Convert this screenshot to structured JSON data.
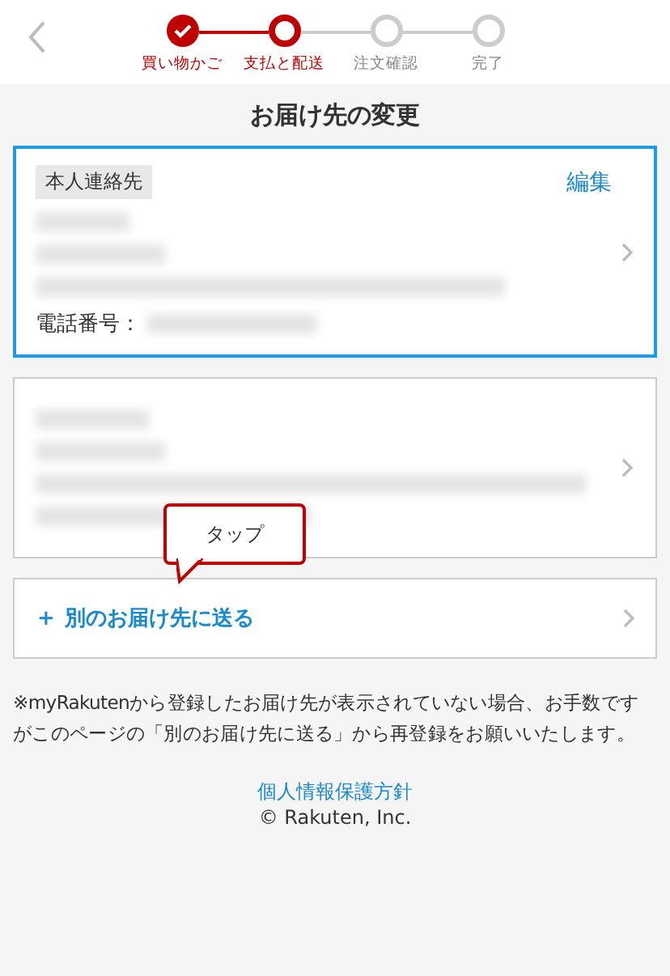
{
  "steps": [
    {
      "label": "買い物かご",
      "done": true,
      "selected": false
    },
    {
      "label": "支払と配送",
      "done": false,
      "selected": true
    },
    {
      "label": "注文確認",
      "done": false,
      "selected": false
    },
    {
      "label": "完了",
      "done": false,
      "selected": false
    }
  ],
  "title": "お届け先の変更",
  "addresses": [
    {
      "tag": "本人連絡先",
      "edit": "編集",
      "phone_label": "電話番号：",
      "selected": true
    },
    {
      "selected": false
    }
  ],
  "tooltip": "タップ",
  "add_address": {
    "icon": "+",
    "label": "別のお届け先に送る"
  },
  "note": "※myRakutenから登録したお届け先が表示されていない場合、お手数ですがこのページの「別のお届け先に送る」から再登録をお願いいたします。",
  "footer": {
    "link": "個人情報保護方針",
    "copyright": "© Rakuten, Inc."
  }
}
